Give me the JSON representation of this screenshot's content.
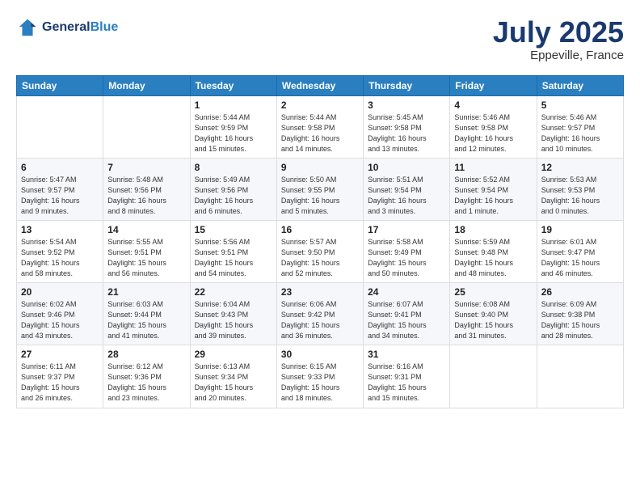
{
  "header": {
    "logo_line1": "General",
    "logo_line2": "Blue",
    "month_title": "July 2025",
    "location": "Eppeville, France"
  },
  "weekdays": [
    "Sunday",
    "Monday",
    "Tuesday",
    "Wednesday",
    "Thursday",
    "Friday",
    "Saturday"
  ],
  "weeks": [
    [
      {
        "day": "",
        "info": ""
      },
      {
        "day": "",
        "info": ""
      },
      {
        "day": "1",
        "info": "Sunrise: 5:44 AM\nSunset: 9:59 PM\nDaylight: 16 hours\nand 15 minutes."
      },
      {
        "day": "2",
        "info": "Sunrise: 5:44 AM\nSunset: 9:58 PM\nDaylight: 16 hours\nand 14 minutes."
      },
      {
        "day": "3",
        "info": "Sunrise: 5:45 AM\nSunset: 9:58 PM\nDaylight: 16 hours\nand 13 minutes."
      },
      {
        "day": "4",
        "info": "Sunrise: 5:46 AM\nSunset: 9:58 PM\nDaylight: 16 hours\nand 12 minutes."
      },
      {
        "day": "5",
        "info": "Sunrise: 5:46 AM\nSunset: 9:57 PM\nDaylight: 16 hours\nand 10 minutes."
      }
    ],
    [
      {
        "day": "6",
        "info": "Sunrise: 5:47 AM\nSunset: 9:57 PM\nDaylight: 16 hours\nand 9 minutes."
      },
      {
        "day": "7",
        "info": "Sunrise: 5:48 AM\nSunset: 9:56 PM\nDaylight: 16 hours\nand 8 minutes."
      },
      {
        "day": "8",
        "info": "Sunrise: 5:49 AM\nSunset: 9:56 PM\nDaylight: 16 hours\nand 6 minutes."
      },
      {
        "day": "9",
        "info": "Sunrise: 5:50 AM\nSunset: 9:55 PM\nDaylight: 16 hours\nand 5 minutes."
      },
      {
        "day": "10",
        "info": "Sunrise: 5:51 AM\nSunset: 9:54 PM\nDaylight: 16 hours\nand 3 minutes."
      },
      {
        "day": "11",
        "info": "Sunrise: 5:52 AM\nSunset: 9:54 PM\nDaylight: 16 hours\nand 1 minute."
      },
      {
        "day": "12",
        "info": "Sunrise: 5:53 AM\nSunset: 9:53 PM\nDaylight: 16 hours\nand 0 minutes."
      }
    ],
    [
      {
        "day": "13",
        "info": "Sunrise: 5:54 AM\nSunset: 9:52 PM\nDaylight: 15 hours\nand 58 minutes."
      },
      {
        "day": "14",
        "info": "Sunrise: 5:55 AM\nSunset: 9:51 PM\nDaylight: 15 hours\nand 56 minutes."
      },
      {
        "day": "15",
        "info": "Sunrise: 5:56 AM\nSunset: 9:51 PM\nDaylight: 15 hours\nand 54 minutes."
      },
      {
        "day": "16",
        "info": "Sunrise: 5:57 AM\nSunset: 9:50 PM\nDaylight: 15 hours\nand 52 minutes."
      },
      {
        "day": "17",
        "info": "Sunrise: 5:58 AM\nSunset: 9:49 PM\nDaylight: 15 hours\nand 50 minutes."
      },
      {
        "day": "18",
        "info": "Sunrise: 5:59 AM\nSunset: 9:48 PM\nDaylight: 15 hours\nand 48 minutes."
      },
      {
        "day": "19",
        "info": "Sunrise: 6:01 AM\nSunset: 9:47 PM\nDaylight: 15 hours\nand 46 minutes."
      }
    ],
    [
      {
        "day": "20",
        "info": "Sunrise: 6:02 AM\nSunset: 9:46 PM\nDaylight: 15 hours\nand 43 minutes."
      },
      {
        "day": "21",
        "info": "Sunrise: 6:03 AM\nSunset: 9:44 PM\nDaylight: 15 hours\nand 41 minutes."
      },
      {
        "day": "22",
        "info": "Sunrise: 6:04 AM\nSunset: 9:43 PM\nDaylight: 15 hours\nand 39 minutes."
      },
      {
        "day": "23",
        "info": "Sunrise: 6:06 AM\nSunset: 9:42 PM\nDaylight: 15 hours\nand 36 minutes."
      },
      {
        "day": "24",
        "info": "Sunrise: 6:07 AM\nSunset: 9:41 PM\nDaylight: 15 hours\nand 34 minutes."
      },
      {
        "day": "25",
        "info": "Sunrise: 6:08 AM\nSunset: 9:40 PM\nDaylight: 15 hours\nand 31 minutes."
      },
      {
        "day": "26",
        "info": "Sunrise: 6:09 AM\nSunset: 9:38 PM\nDaylight: 15 hours\nand 28 minutes."
      }
    ],
    [
      {
        "day": "27",
        "info": "Sunrise: 6:11 AM\nSunset: 9:37 PM\nDaylight: 15 hours\nand 26 minutes."
      },
      {
        "day": "28",
        "info": "Sunrise: 6:12 AM\nSunset: 9:36 PM\nDaylight: 15 hours\nand 23 minutes."
      },
      {
        "day": "29",
        "info": "Sunrise: 6:13 AM\nSunset: 9:34 PM\nDaylight: 15 hours\nand 20 minutes."
      },
      {
        "day": "30",
        "info": "Sunrise: 6:15 AM\nSunset: 9:33 PM\nDaylight: 15 hours\nand 18 minutes."
      },
      {
        "day": "31",
        "info": "Sunrise: 6:16 AM\nSunset: 9:31 PM\nDaylight: 15 hours\nand 15 minutes."
      },
      {
        "day": "",
        "info": ""
      },
      {
        "day": "",
        "info": ""
      }
    ]
  ]
}
